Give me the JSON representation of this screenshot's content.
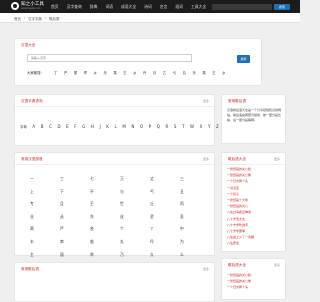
{
  "site": {
    "name": "知之小工具",
    "sub": "www.bigebj.com"
  },
  "nav": [
    "首页",
    "汉字查询",
    "辞典",
    "词语",
    "成语大全",
    "诗词",
    "名言",
    "组词",
    "工具大全"
  ],
  "search_btn": "搜索",
  "breadcrumb": {
    "home": "首页",
    "sep": "›",
    "mid": "汉字字典",
    "current": "歇后语"
  },
  "current_label": "您的位置：",
  "card_search": {
    "title": "汉语大全",
    "placeholder": "请输入汉字",
    "button": "搜索",
    "label": "大家都搜：",
    "radicals": [
      "丁",
      "严",
      "丽",
      "举",
      "乡",
      "乐",
      "乘",
      "乞",
      "乡",
      "丹",
      "月",
      "乙",
      "亏",
      "丸",
      "乐",
      "乘",
      "乞",
      "乡"
    ]
  },
  "card_pinyin": {
    "title": "汉语字典查询",
    "more": "更多",
    "prefix": "字母",
    "letters": [
      "A",
      "B",
      "C",
      "D",
      "E",
      "F",
      "G",
      "H",
      "J",
      "K",
      "L",
      "M",
      "N",
      "O",
      "P",
      "Q",
      "R",
      "S",
      "T",
      "W",
      "X",
      "Y",
      "Z"
    ]
  },
  "card_radical": {
    "title": "常用汉语部首",
    "more": "更多",
    "cells": [
      "一",
      "丁",
      "七",
      "万",
      "丈",
      "三",
      "上",
      "下",
      "不",
      "与",
      "丐",
      "丑",
      "专",
      "且",
      "丕",
      "世",
      "丘",
      "丙",
      "业",
      "丛",
      "东",
      "丝",
      "丞",
      "丢",
      "两",
      "严",
      "丧",
      "个",
      "丫",
      "中",
      "丰",
      "串",
      "临",
      "丸",
      "丹",
      "为",
      "主",
      "丽",
      "举",
      "乃",
      "久",
      "么",
      "义",
      "之",
      "乌",
      "乍",
      "乎",
      "乏"
    ]
  },
  "card_extra": {
    "title": "常用歇后语",
    "more": "更多"
  },
  "right_top": {
    "title": "常用歇后语",
    "desc": "汉语歇后语大全是一个分享经验知识的网站。歇后语由两部分组成，前一部分是比喻，后一部分是解释。"
  },
  "right_list": {
    "title": "歇后语大全",
    "more": "更多",
    "items": [
      "一张纸画的关公脸",
      "一张纸画的关公像",
      "一个扫帚两个头",
      "一对活宝",
      "一个筛子",
      "一张纸画个大象",
      "一张纸画的关公",
      "八仙过海各显神通",
      "八十岁老太太",
      "八十岁学吹鼓手",
      "八十岁学耍拳",
      "八仙桌上少了一条腿",
      "八仙聚会"
    ]
  },
  "right_list2": {
    "title": "歇后语大全",
    "more": "更多",
    "items": [
      "一张纸画的关公脸",
      "一张纸画的关公像",
      "一个扫帚两个头"
    ]
  }
}
